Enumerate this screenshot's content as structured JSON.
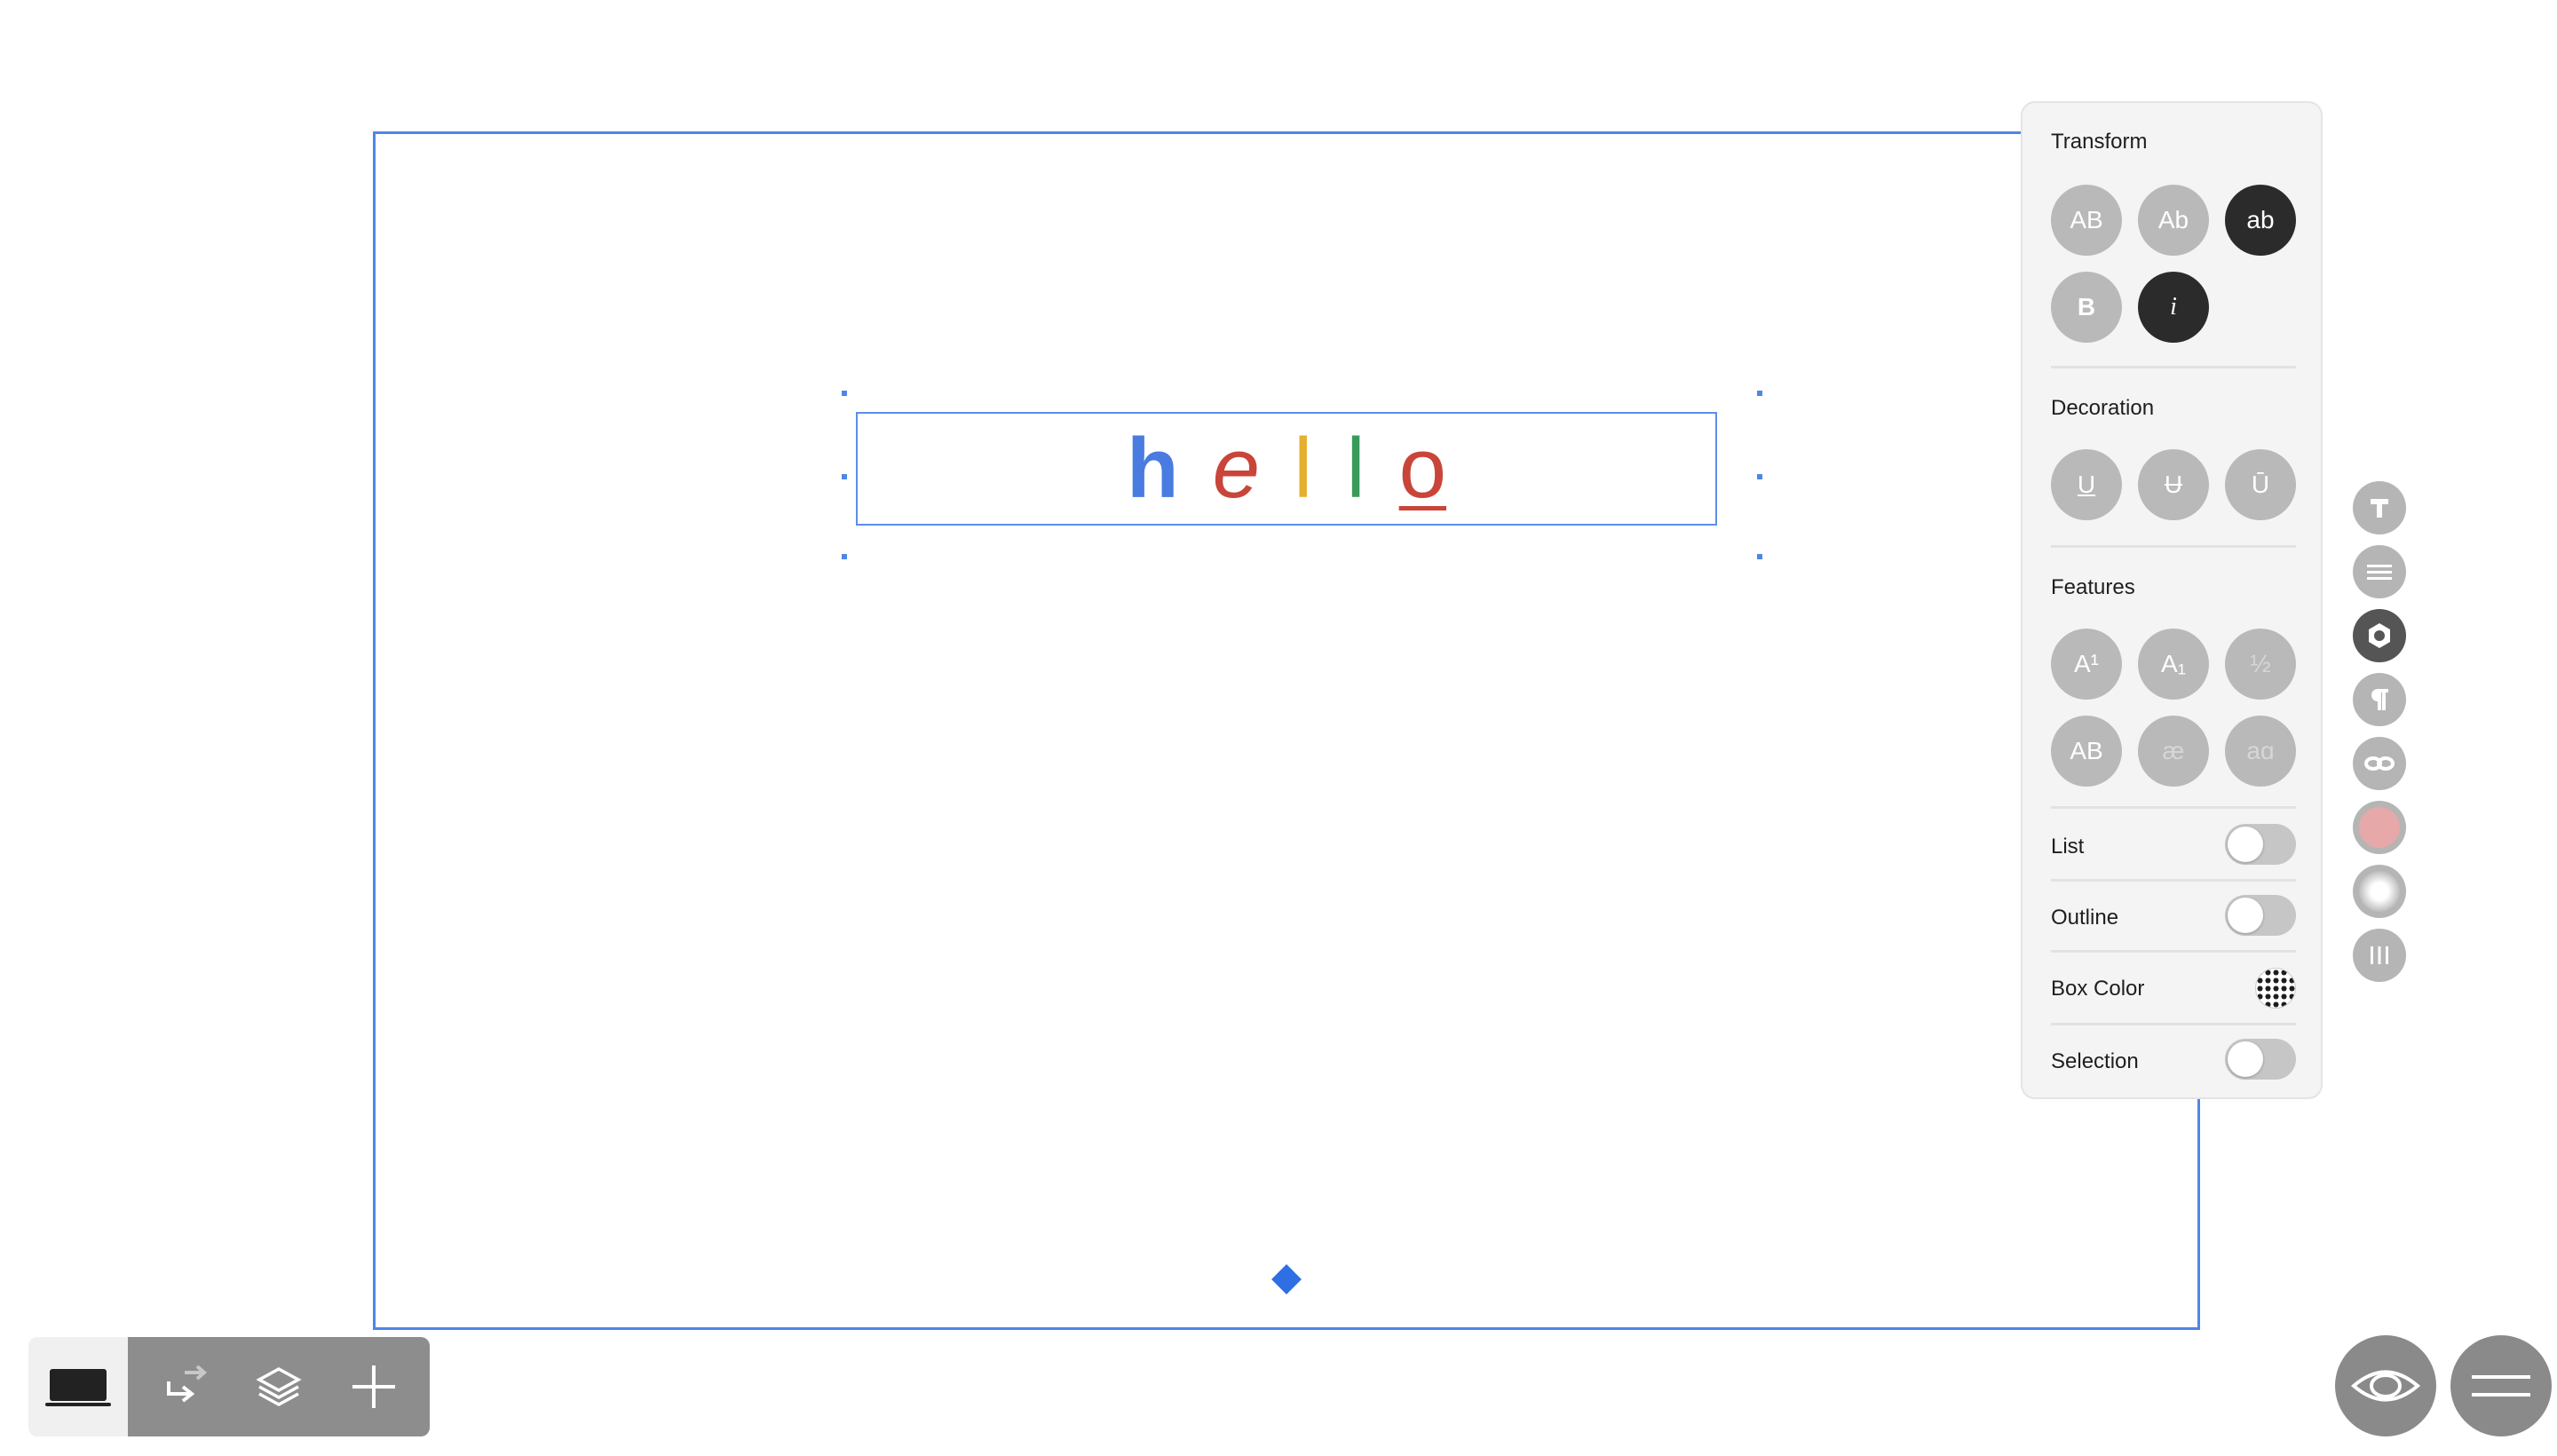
{
  "canvas": {
    "text_letters": [
      "h",
      "e",
      "l",
      "l",
      "o"
    ],
    "letter_colors": [
      "#4a7be0",
      "#c9453a",
      "#e5b02d",
      "#3a9a5a",
      "#c9453a"
    ]
  },
  "panel": {
    "transform": {
      "title": "Transform",
      "buttons": [
        "AB",
        "Ab",
        "ab",
        "B",
        "i"
      ]
    },
    "decoration": {
      "title": "Decoration",
      "buttons": [
        "U",
        "U",
        "Ū"
      ]
    },
    "features": {
      "title": "Features",
      "buttons": [
        "A¹",
        "A₁",
        "½",
        "AB",
        "æ",
        "aɑ"
      ]
    },
    "rows": {
      "list": "List",
      "outline": "Outline",
      "box_color": "Box Color",
      "selection": "Selection"
    }
  },
  "rail": {
    "icons": [
      "text-icon",
      "align-icon",
      "style-icon",
      "paragraph-icon",
      "link-icon",
      "color-icon",
      "shadow-icon",
      "columns-icon"
    ],
    "color_swatch": "#e6a8a8"
  },
  "toolbar": {
    "icons": [
      "device-icon",
      "return-icon",
      "layers-icon",
      "plus-icon"
    ]
  },
  "colors": {
    "accent": "#4f86e6",
    "panel_bg": "#f4f4f4",
    "button_grey": "#b9b9b9",
    "button_dark": "#2b2b2b"
  }
}
